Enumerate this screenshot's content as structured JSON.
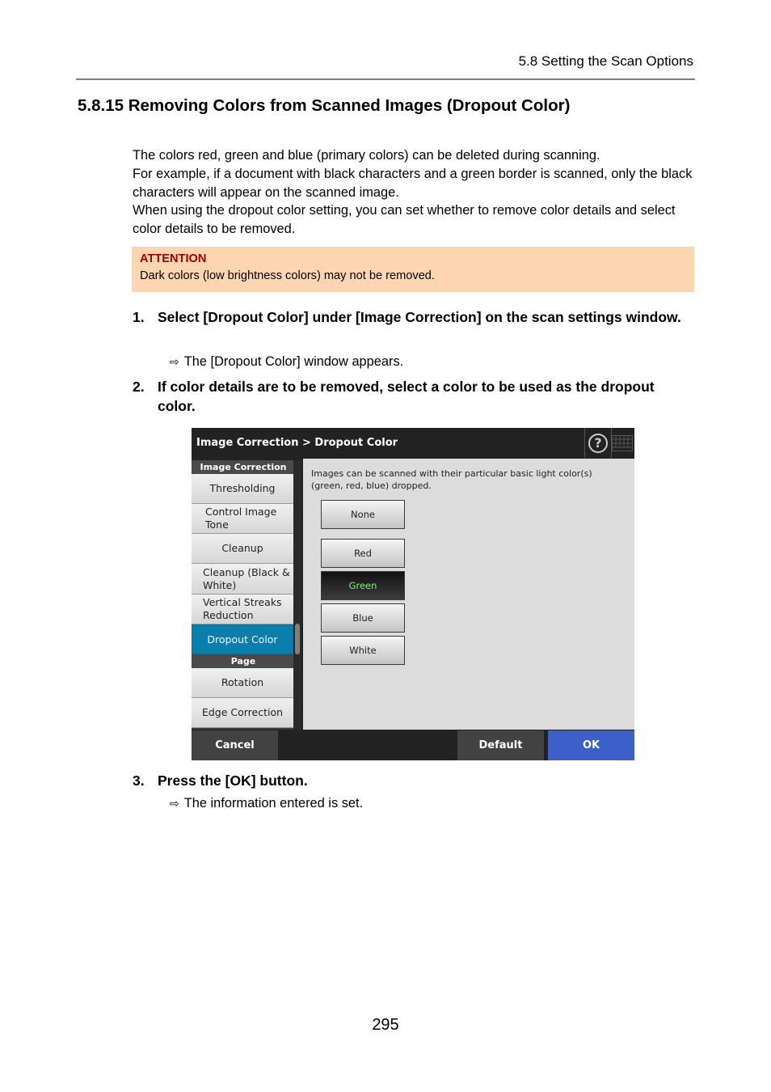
{
  "running_header": "5.8 Setting the Scan Options",
  "section_title": "5.8.15 Removing Colors from Scanned Images (Dropout Color)",
  "intro_paragraphs": [
    "The colors red, green and blue (primary colors) can be deleted during scanning.",
    "For example, if a document with black characters and a green border is scanned, only the black characters will appear on the scanned image.",
    "When using the dropout color setting, you can set whether to remove color details and select color details to be removed."
  ],
  "attention": {
    "title": "ATTENTION",
    "text": "Dark colors (low brightness colors) may not be removed."
  },
  "steps": [
    {
      "number": "1.",
      "text": "Select [Dropout Color] under [Image Correction] on the scan settings window.",
      "result": "The [Dropout Color] window appears."
    },
    {
      "number": "2.",
      "text": "If color details are to be removed, select a color to be used as the dropout color.",
      "result": ""
    },
    {
      "number": "3.",
      "text": "Press the [OK] button.",
      "result": "The information entered is set."
    }
  ],
  "result_arrow_icon": "⇨",
  "screen": {
    "breadcrumb": "Image Correction > Dropout Color",
    "help_icon": "?",
    "sidebar": {
      "groups": [
        {
          "label": "Image Correction",
          "items": [
            "Thresholding",
            "Control Image Tone",
            "Cleanup",
            "Cleanup (Black & White)",
            "Vertical Streaks Reduction",
            "Dropout Color"
          ]
        },
        {
          "label": "Page",
          "items": [
            "Rotation",
            "Edge Correction"
          ]
        }
      ],
      "active_item": "Dropout Color"
    },
    "description": "Images can be scanned with their particular basic light color(s) (green, red, blue) dropped.",
    "options": [
      "None",
      "Red",
      "Green",
      "Blue",
      "White"
    ],
    "selected_option": "Green",
    "footer": {
      "cancel": "Cancel",
      "default": "Default",
      "ok": "OK"
    }
  },
  "page_number": "295"
}
